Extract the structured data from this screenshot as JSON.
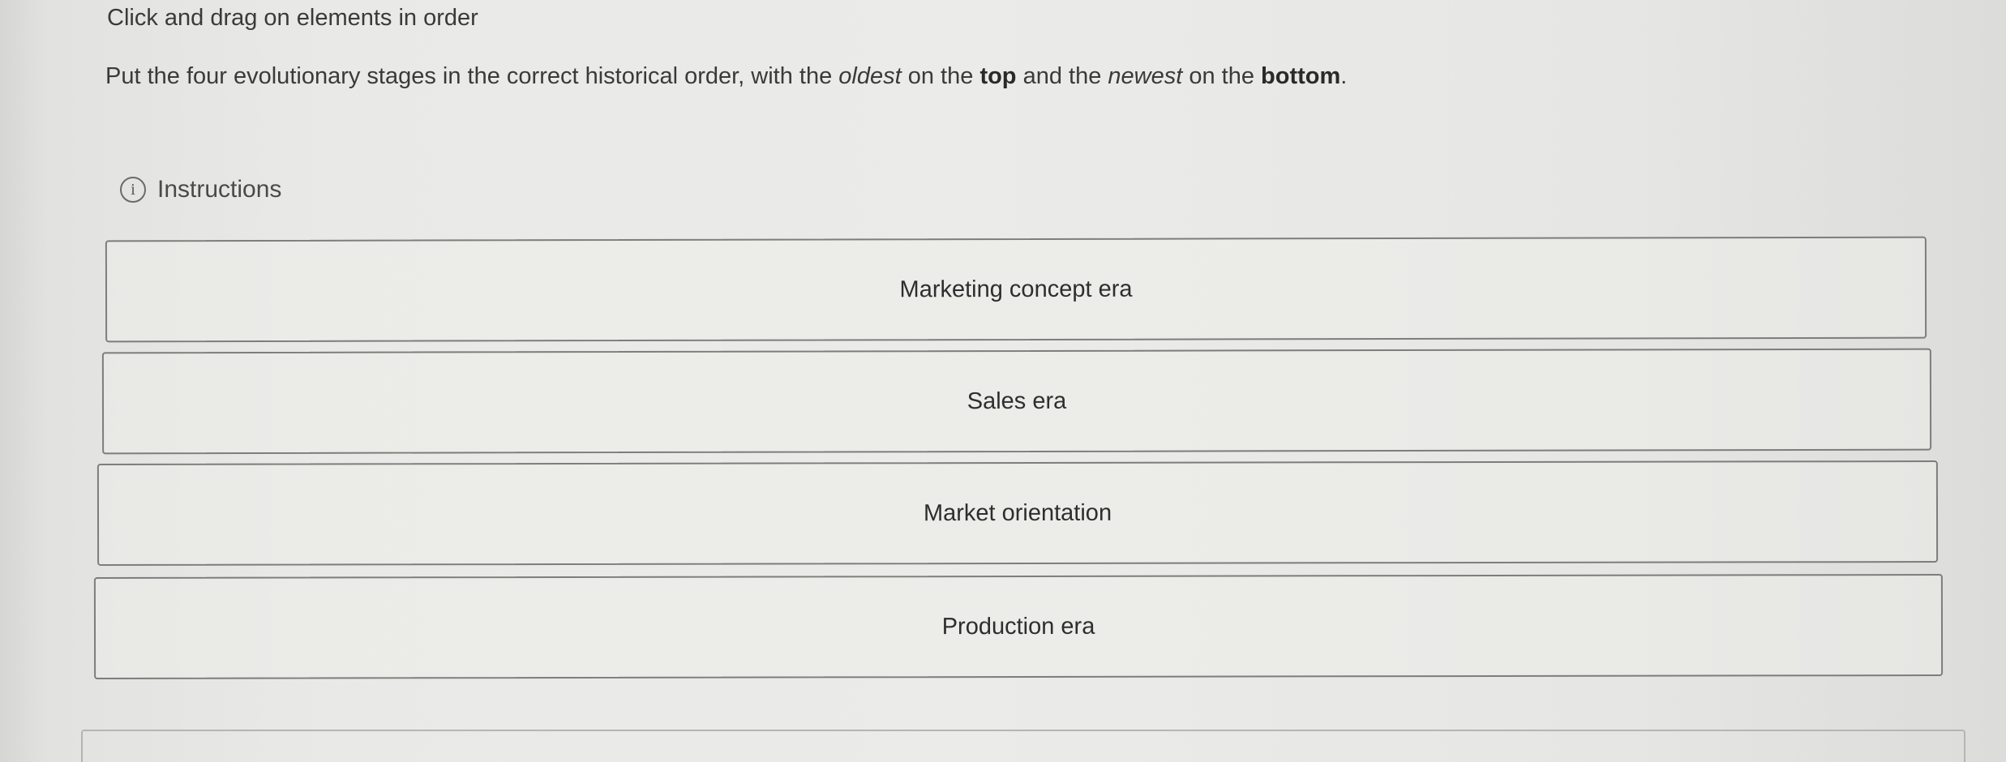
{
  "prompt": {
    "heading": "Click and drag on elements in order"
  },
  "question": {
    "part1": "Put the four evolutionary stages in the correct historical order, with the ",
    "oldest": "oldest",
    "part2": " on the ",
    "top": "top",
    "part3": " and the ",
    "newest": "newest",
    "part4": " on the ",
    "bottom": "bottom",
    "part5": "."
  },
  "instructions": {
    "icon": "info-icon",
    "icon_glyph": "i",
    "label": "Instructions"
  },
  "items": [
    {
      "label": "Marketing concept era"
    },
    {
      "label": "Sales era"
    },
    {
      "label": "Market orientation"
    },
    {
      "label": "Production era"
    }
  ],
  "colors": {
    "background": "#e9e9e7",
    "text": "#333333",
    "border": "#7d7d7d"
  }
}
